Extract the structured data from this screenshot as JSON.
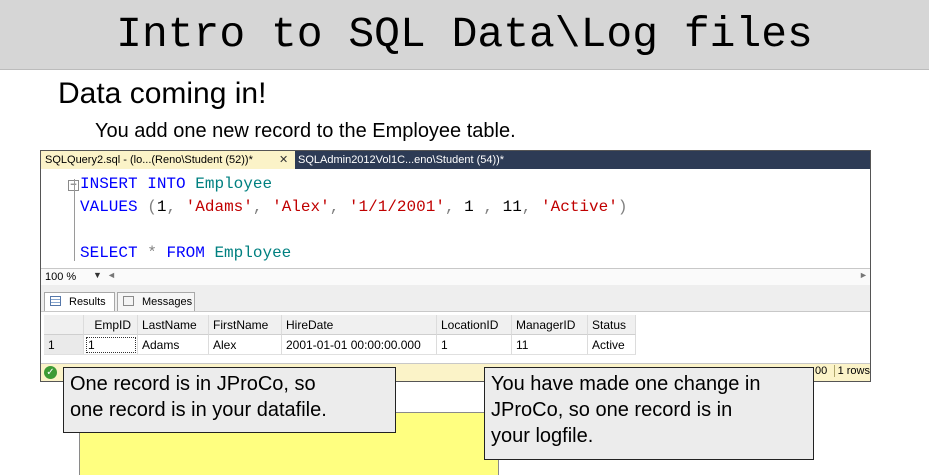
{
  "slide": {
    "title": "Intro to SQL Data\\Log files",
    "heading": "Data coming in!",
    "subheading": "You add one new record to the Employee  table."
  },
  "ssms": {
    "tabs": [
      {
        "label": "SQLQuery2.sql - (lo...(Reno\\Student (52))*",
        "active": true
      },
      {
        "label": "SQLAdmin2012Vol1C...eno\\Student (54))*",
        "active": false
      }
    ],
    "tab_close_glyph": "✕",
    "code": {
      "line1": {
        "kw1": "INSERT",
        "kw2": "INTO",
        "id": "Employee"
      },
      "line2": {
        "kw": "VALUES",
        "open": "(",
        "v1": "1",
        "comma": ",",
        "v2": "'Adams'",
        "v3": "'Alex'",
        "v4": "'1/1/2001'",
        "v5": "1",
        "v6": "11",
        "v7": "'Active'",
        "close": ")"
      },
      "line3": {
        "kw1": "SELECT",
        "star": "*",
        "kw2": "FROM",
        "id": "Employee"
      }
    },
    "zoom": "100 %",
    "results_tabs": {
      "results": "Results",
      "messages": "Messages"
    },
    "grid": {
      "columns": [
        "",
        "EmpID",
        "LastName",
        "FirstName",
        "HireDate",
        "LocationID",
        "ManagerID",
        "Status"
      ],
      "rows": [
        [
          "1",
          "1",
          "Adams",
          "Alex",
          "2001-01-01 00:00:00.000",
          "1",
          "11",
          "Active"
        ]
      ]
    },
    "status": {
      "time": "00",
      "rows": "1 rows"
    }
  },
  "callouts": {
    "left": [
      "One record is in JProCo, so",
      "one record is in your datafile."
    ],
    "right": [
      "You have made one change in",
      "JProCo, so one record is in",
      "your logfile."
    ]
  },
  "colors": {
    "keyword": "#0000ff",
    "identifier": "#008080",
    "string": "#c00000",
    "status_bar": "#fbf3c8",
    "tab_strip": "#2d3b55",
    "panel_yellow": "#ffff80"
  },
  "icons": {
    "fold": "minus-box",
    "results": "grid-icon",
    "messages": "message-icon",
    "status_ok": "check-circle"
  }
}
